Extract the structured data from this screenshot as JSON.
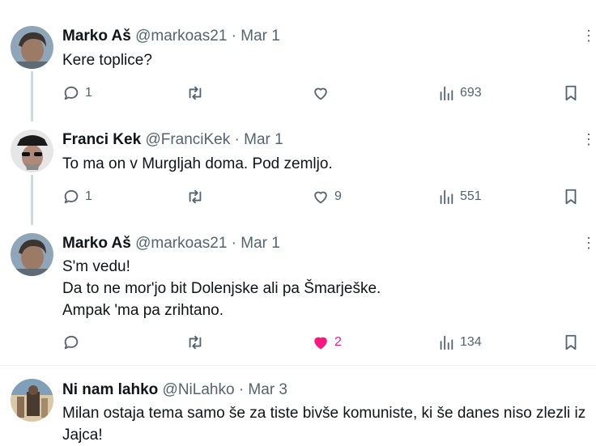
{
  "tweets": [
    {
      "name": "Marko Aš",
      "handle": "@markoas21",
      "dot": "·",
      "date": "Mar 1",
      "lines": [
        "Kere toplice?"
      ],
      "replies": "1",
      "retweets": "",
      "likes": "",
      "views": "693",
      "liked": false
    },
    {
      "name": "Franci Kek",
      "handle": "@FranciKek",
      "dot": "·",
      "date": "Mar 1",
      "lines": [
        "To ma on v Murgljah doma. Pod zemljo."
      ],
      "replies": "1",
      "retweets": "",
      "likes": "9",
      "views": "551",
      "liked": false
    },
    {
      "name": "Marko Aš",
      "handle": "@markoas21",
      "dot": "·",
      "date": "Mar 1",
      "lines": [
        "S'm vedu!",
        "Da to ne mor'jo bit Dolenjske ali pa Šmarješke.",
        "Ampak 'ma pa zrihtano."
      ],
      "replies": "",
      "retweets": "",
      "likes": "2",
      "views": "134",
      "liked": true
    },
    {
      "name": "Ni nam lahko",
      "handle": "@NiLahko",
      "dot": "·",
      "date": "Mar 3",
      "lines": [
        "Milan ostaja tema samo še za tiste bivše komuniste, ki še danes niso zlezli iz",
        "Jajca!"
      ]
    }
  ],
  "colors": {
    "like_active": "#f91880",
    "muted": "#536471",
    "thread_line": "#cfd9de"
  },
  "icons": [
    "reply-icon",
    "retweet-icon",
    "like-icon",
    "views-icon",
    "bookmark-icon",
    "more-icon"
  ]
}
